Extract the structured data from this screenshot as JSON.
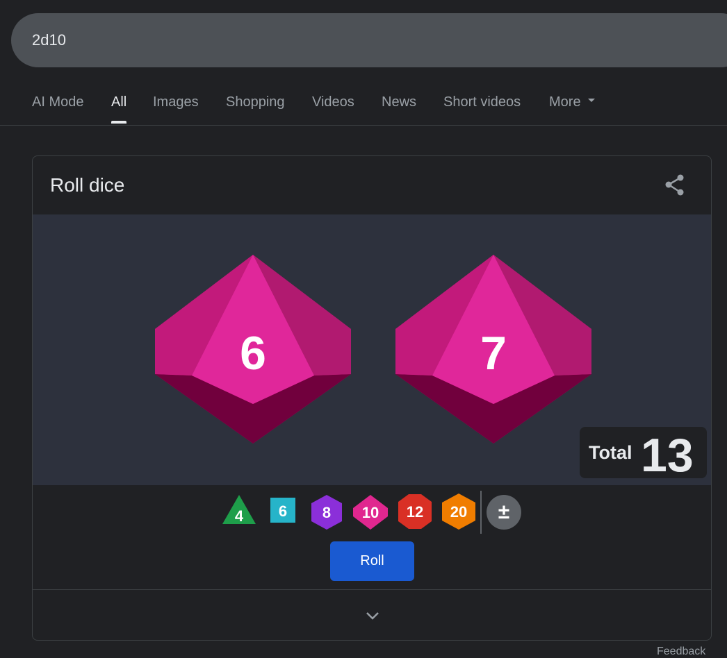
{
  "search": {
    "query": "2d10"
  },
  "tabs": [
    {
      "label": "AI Mode"
    },
    {
      "label": "All"
    },
    {
      "label": "Images"
    },
    {
      "label": "Shopping"
    },
    {
      "label": "Videos"
    },
    {
      "label": "News"
    },
    {
      "label": "Short videos"
    },
    {
      "label": "More"
    }
  ],
  "card": {
    "title": "Roll dice",
    "dice": [
      {
        "value": "6"
      },
      {
        "value": "7"
      }
    ],
    "total_label": "Total",
    "total_value": "13",
    "die_buttons": [
      {
        "label": "4",
        "color": "#1e9e4a"
      },
      {
        "label": "6",
        "color": "#26b4c9"
      },
      {
        "label": "8",
        "color": "#8b2fd9"
      },
      {
        "label": "10",
        "color": "#e0278f"
      },
      {
        "label": "12",
        "color": "#d93025"
      },
      {
        "label": "20",
        "color": "#f07d00"
      }
    ],
    "modifier_label": "±",
    "roll_label": "Roll",
    "die_color": "#e0278f"
  },
  "feedback_label": "Feedback"
}
